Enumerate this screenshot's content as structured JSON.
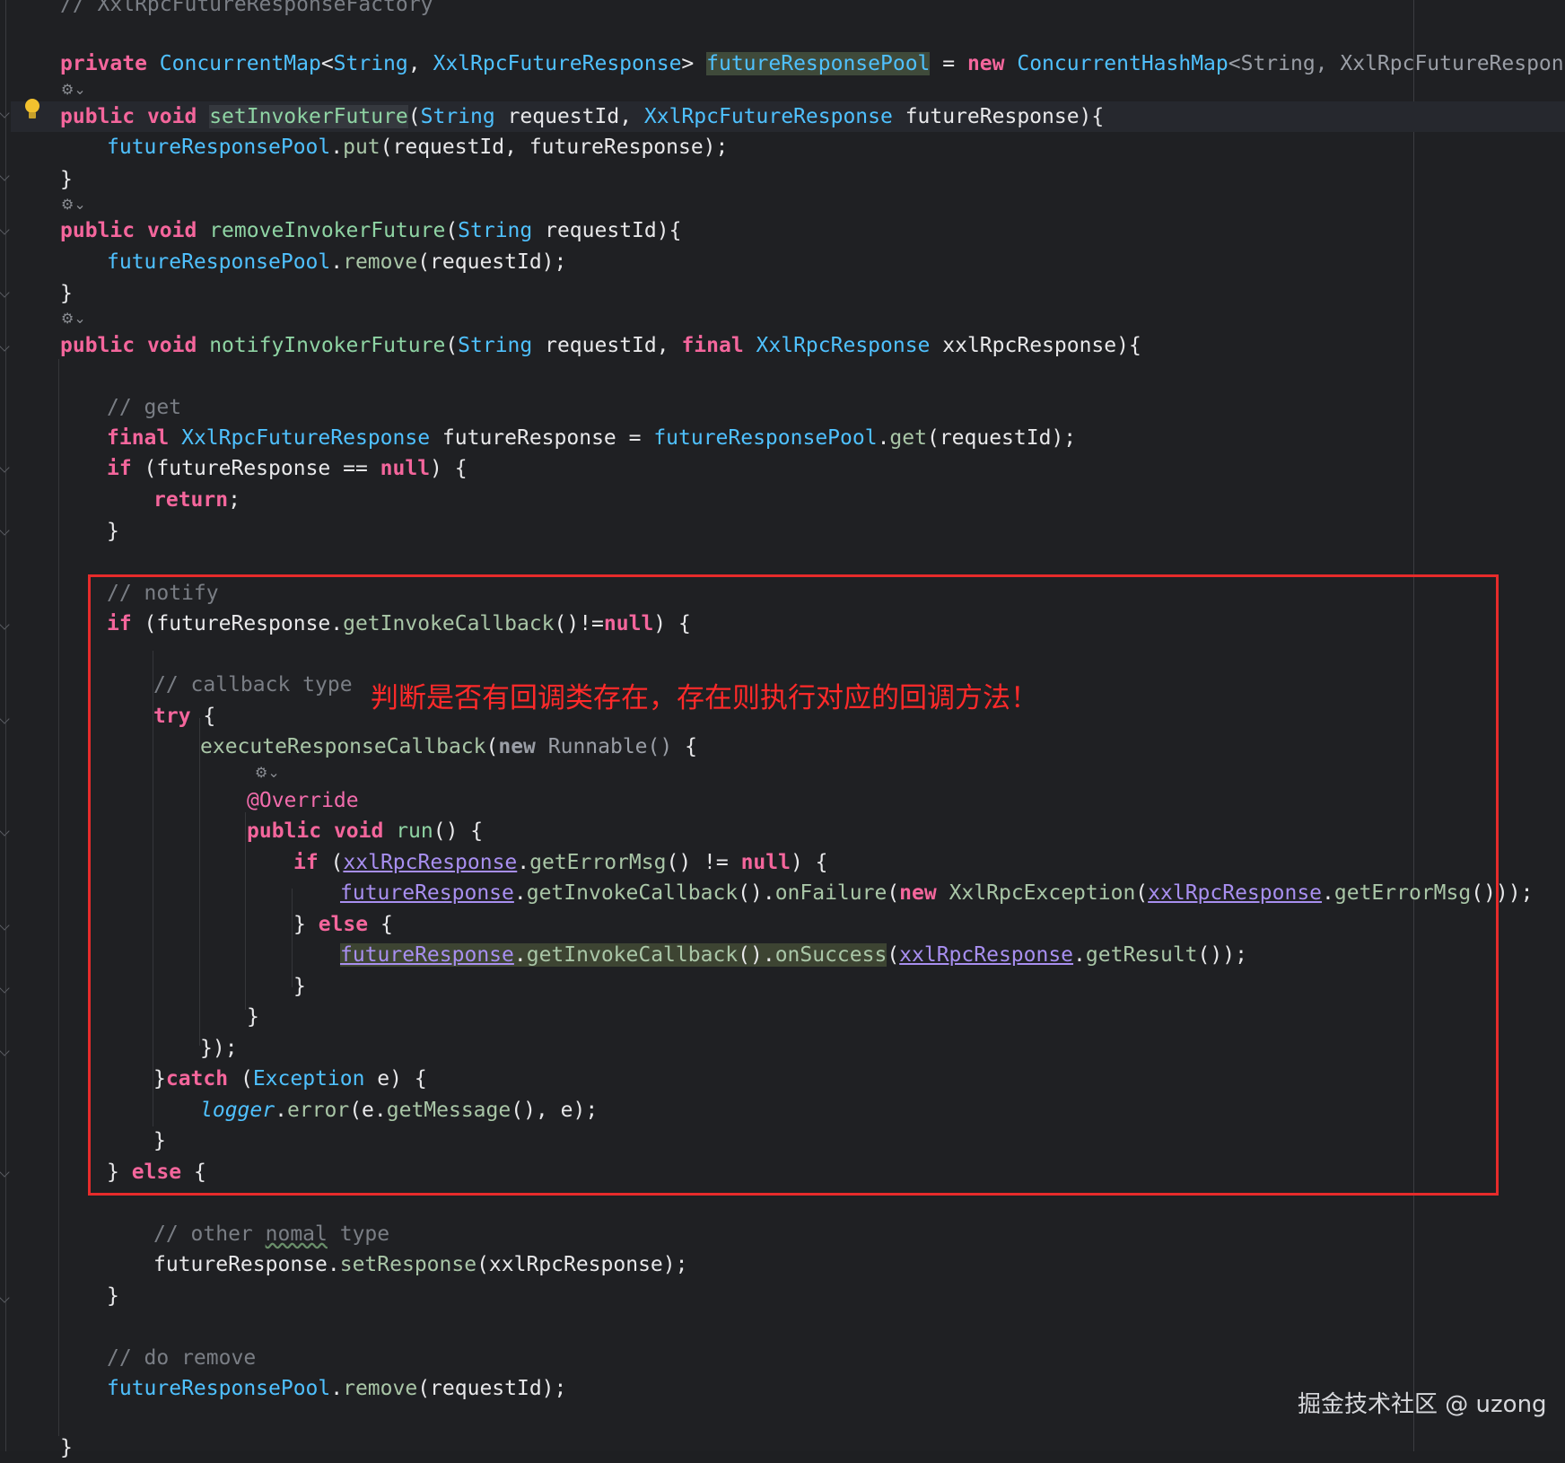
{
  "editor": {
    "top_comment": "// XxlRpcFutureResponseFactory",
    "decl": {
      "kw_private": "private",
      "type_map": "ConcurrentMap",
      "generic_open": "<",
      "type_string": "String",
      "comma": ", ",
      "type_resp": "XxlRpcFutureResponse",
      "generic_close": ">",
      "field": "futureResponsePool",
      "eq": " = ",
      "kw_new": "new",
      "type_hashmap": "ConcurrentHashMap",
      "generic_args": "<String, XxlRpcFutureResponse>",
      "end": "();"
    },
    "set_method": {
      "kw_public": "public",
      "kw_void": "void",
      "name": "setInvokerFuture",
      "p_open": "(",
      "t_string": "String",
      "arg1": " requestId, ",
      "t_resp": "XxlRpcFutureResponse",
      "arg2": " futureResponse){",
      "body_field": "futureResponsePool",
      "dot": ".",
      "put": "put",
      "put_args": "(requestId, futureResponse);",
      "close": "}"
    },
    "remove_method": {
      "kw_public": "public",
      "kw_void": "void",
      "name": "removeInvokerFuture",
      "p_open": "(",
      "t_string": "String",
      "arg": " requestId){",
      "body_field": "futureResponsePool",
      "dot": ".",
      "remove": "remove",
      "remove_args": "(requestId);",
      "close": "}"
    },
    "notify_method": {
      "kw_public": "public",
      "kw_void": "void",
      "name": "notifyInvokerFuture",
      "p_open": "(",
      "t_string": "String",
      "arg1": " requestId, ",
      "kw_final": "final",
      "t_rpcresp": "XxlRpcResponse",
      "arg2": " xxlRpcResponse){"
    },
    "body": {
      "c_get": "// get",
      "kw_final": "final",
      "t_resp": "XxlRpcFutureResponse",
      "var_decl": " futureResponse = ",
      "pool": "futureResponsePool",
      "dot": ".",
      "get": "get",
      "get_args": "(requestId);",
      "kw_if": "if",
      "if_cond": " (futureResponse == ",
      "kw_null": "null",
      "if_end": ") {",
      "kw_return": "return",
      "semi": ";",
      "close": "}",
      "c_notify": "// notify",
      "if2_open": " (futureResponse.",
      "getInvokeCallback": "getInvokeCallback",
      "neq": "()!=",
      "c_callback": "// callback type",
      "kw_try": "try",
      "brace_open": " {",
      "execute": "executeResponseCallback",
      "paren_open": "(",
      "kw_new": "new",
      "runnable": " Runnable()",
      "ann_override": "@Override",
      "run": "run",
      "run_end": "() {",
      "if3_open": " (",
      "xxlRpcResponse": "xxlRpcResponse",
      "getErrorMsg": "getErrorMsg",
      "neq_null": "() != ",
      "futureResponse": "futureResponse",
      "onFailure": "onFailure",
      "t_exception": "XxlRpcException",
      "tail_fail": "()));",
      "kw_else": "else",
      "else_line": "} ",
      "onSuccess": "onSuccess",
      "getResult": "getResult",
      "tail_success": "());",
      "close_paren": "});",
      "catch_open": "}",
      "kw_catch": "catch",
      "t_exc": "Exception",
      "catch_args": " e) {",
      "logger": "logger",
      "error": "error",
      "error_open": "(e.",
      "getMessage": "getMessage",
      "error_end": "(), e);",
      "c_other": "// other ",
      "c_nomal": "nomal",
      "c_type": " type",
      "setResponse": "setResponse",
      "set_args": "(xxlRpcResponse);",
      "c_remove": "// do remove",
      "remove": "remove",
      "remove_args": "(requestId);"
    }
  },
  "overlay": {
    "annotation_text": "判断是否有回调类存在，存在则执行对应的回调方法！",
    "watermark": "掘金技术社区 @ uzong",
    "inlay_icon": "⚙⌄",
    "highlight_color": "#e62b2b"
  }
}
